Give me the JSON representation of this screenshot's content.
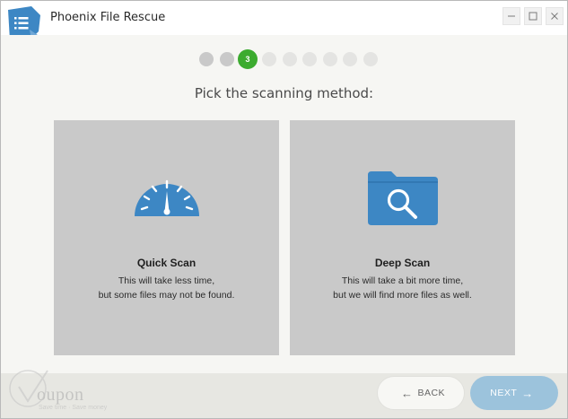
{
  "app": {
    "title": "Phoenix File Rescue"
  },
  "window_controls": {
    "minimize": {
      "icon": "minimize-icon"
    },
    "maximize": {
      "icon": "maximize-icon"
    },
    "close": {
      "icon": "close-icon"
    }
  },
  "steps": {
    "total": 9,
    "current": 3,
    "current_label": "3"
  },
  "heading": "Pick the scanning method:",
  "options": {
    "quick": {
      "title": "Quick Scan",
      "desc_line1": "This will take less time,",
      "desc_line2": "but some files may not be found.",
      "icon": "speedometer-icon"
    },
    "deep": {
      "title": "Deep Scan",
      "desc_line1": "This will take a bit more time,",
      "desc_line2": "but we will find more files as well.",
      "icon": "folder-search-icon"
    }
  },
  "footer": {
    "back_label": "BACK",
    "next_label": "NEXT",
    "back_icon": "arrow-left-icon",
    "next_icon": "arrow-right-icon"
  },
  "watermark": {
    "text": "oupon",
    "tagline": "Save time · Save money"
  },
  "colors": {
    "accent_blue": "#3d87c4",
    "step_active": "#3cab2f",
    "card_bg": "#c9c9c9",
    "next_button": "#9cc3dc"
  }
}
